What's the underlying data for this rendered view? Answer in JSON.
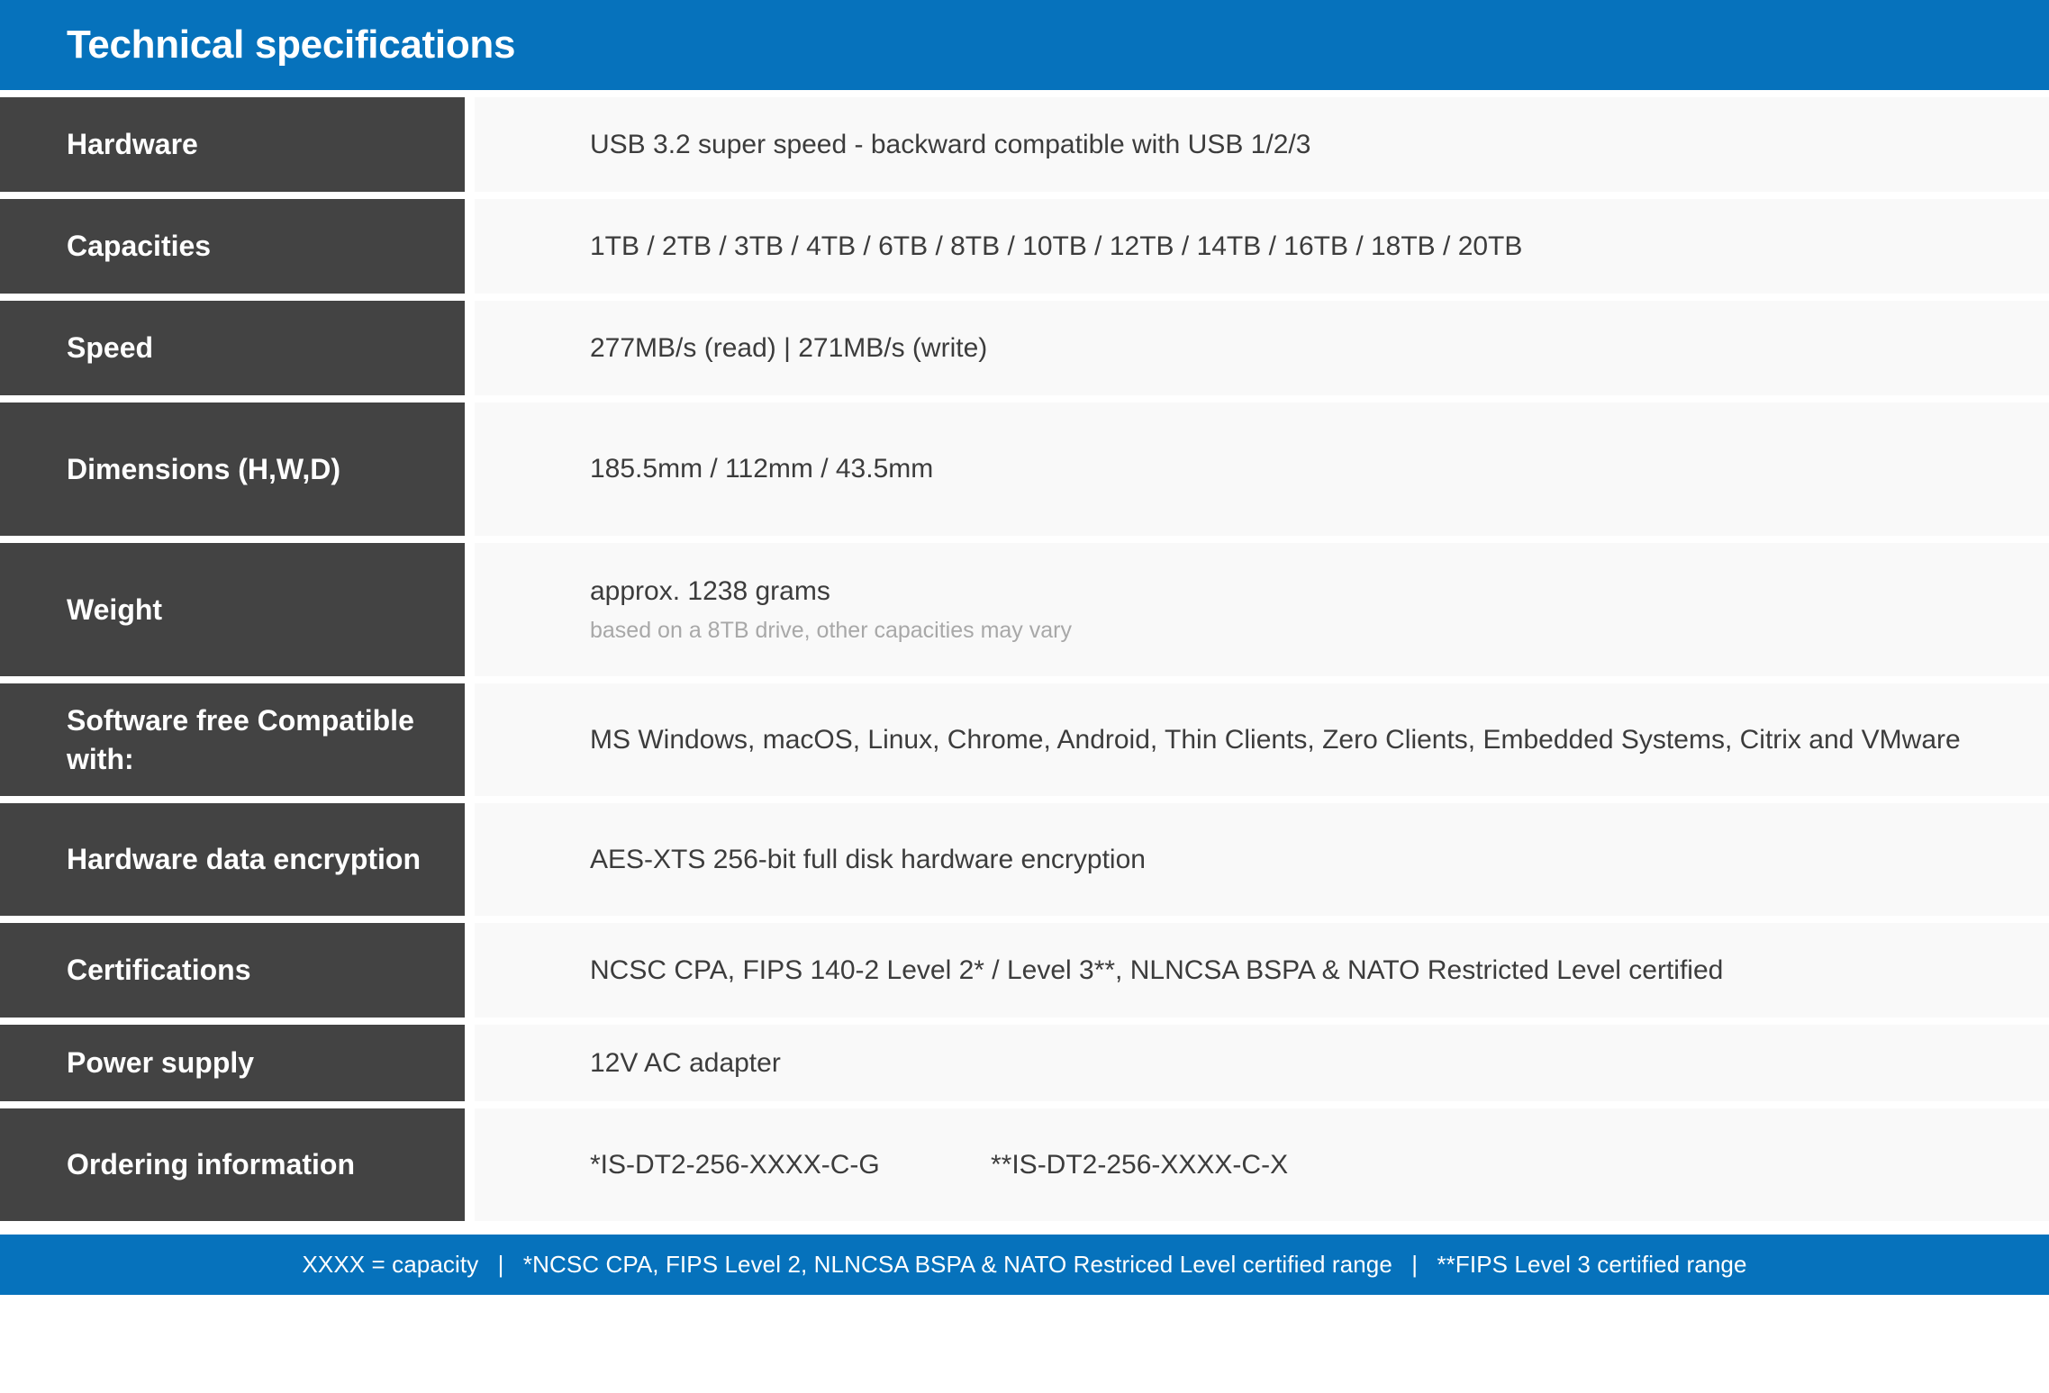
{
  "header": {
    "title": "Technical specifications"
  },
  "colors": {
    "brand_blue": "#0672bc",
    "label_dark": "#434343",
    "value_bg": "#f9f9f9",
    "value_text": "#3c3c3c",
    "sub_text": "#a8a8a8",
    "white": "#ffffff"
  },
  "rows": [
    {
      "label": "Hardware",
      "value": "USB 3.2 super speed - backward compatible with USB 1/2/3"
    },
    {
      "label": "Capacities",
      "value": "1TB / 2TB / 3TB / 4TB / 6TB / 8TB / 10TB / 12TB / 14TB / 16TB / 18TB / 20TB"
    },
    {
      "label": "Speed",
      "value": "277MB/s (read) | 271MB/s (write)"
    },
    {
      "label": "Dimensions (H,W,D)",
      "value": "185.5mm / 112mm / 43.5mm"
    },
    {
      "label": "Weight",
      "value": "approx. 1238 grams",
      "sub": "based on a 8TB drive, other capacities may vary"
    },
    {
      "label": "Software free Compatible with:",
      "value": "MS Windows, macOS, Linux, Chrome, Android, Thin Clients, Zero Clients, Embedded Systems, Citrix and VMware"
    },
    {
      "label": "Hardware data encryption",
      "value": "AES-XTS 256-bit full disk hardware encryption"
    },
    {
      "label": "Certifications",
      "value": "NCSC CPA, FIPS 140-2 Level 2* / Level 3**, NLNCSA BSPA & NATO Restricted Level certified"
    },
    {
      "label": "Power supply",
      "value": "12V AC adapter"
    },
    {
      "label": "Ordering information",
      "value_a": "*IS-DT2-256-XXXX-C-G",
      "value_b": "**IS-DT2-256-XXXX-C-X"
    }
  ],
  "footer": {
    "note_1": "XXXX = capacity",
    "separator_1": "|",
    "note_2": "*NCSC CPA, FIPS Level 2, NLNCSA BSPA & NATO Restriced Level certified range",
    "separator_2": "|",
    "note_3": "**FIPS Level 3 certified range"
  }
}
